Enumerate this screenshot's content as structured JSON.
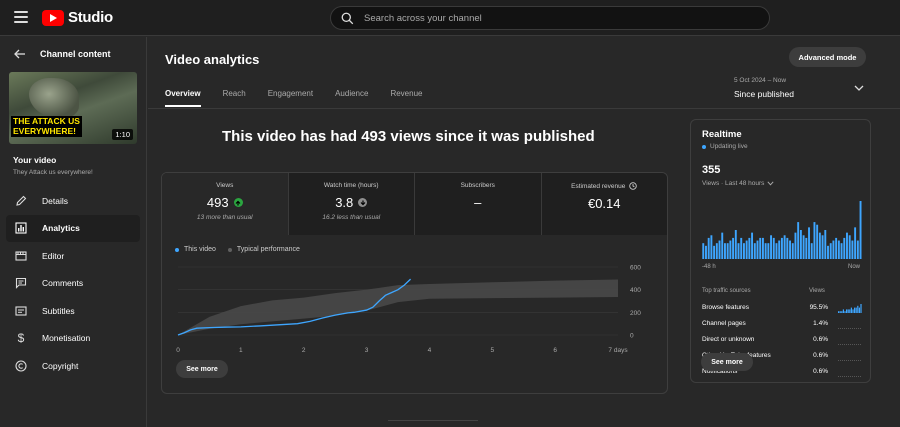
{
  "header": {
    "brand": "Studio",
    "search_placeholder": "Search across your channel"
  },
  "sidebar": {
    "back_label": "Channel content",
    "thumbnail": {
      "caption_line1": "THE ATTACK US",
      "caption_line2": "EVERYWHERE!",
      "duration": "1:10"
    },
    "video_title": "Your video",
    "video_subtitle": "They Attack us everywhere!",
    "items": [
      {
        "label": "Details",
        "icon": "pencil-icon"
      },
      {
        "label": "Analytics",
        "icon": "analytics-icon",
        "active": true
      },
      {
        "label": "Editor",
        "icon": "editor-icon"
      },
      {
        "label": "Comments",
        "icon": "comments-icon"
      },
      {
        "label": "Subtitles",
        "icon": "subtitles-icon"
      },
      {
        "label": "Monetisation",
        "icon": "dollar-icon"
      },
      {
        "label": "Copyright",
        "icon": "copyright-icon"
      }
    ]
  },
  "main": {
    "title": "Video analytics",
    "advanced_mode": "Advanced mode",
    "tabs": [
      {
        "label": "Overview",
        "active": true
      },
      {
        "label": "Reach"
      },
      {
        "label": "Engagement"
      },
      {
        "label": "Audience"
      },
      {
        "label": "Revenue"
      }
    ],
    "date_range": {
      "line1": "5 Oct 2024 – Now",
      "line2": "Since published"
    },
    "headline": "This video has had 493 views since it was published",
    "metrics": [
      {
        "label": "Views",
        "value": "493",
        "sub": "13 more than usual",
        "badge": "up",
        "active": true
      },
      {
        "label": "Watch time (hours)",
        "value": "3.8",
        "sub": "16.2 less than usual",
        "badge": "down"
      },
      {
        "label": "Subscribers",
        "value": "–",
        "sub": ""
      },
      {
        "label": "Estimated revenue",
        "value": "€0.14",
        "sub": "",
        "info": true
      }
    ],
    "legend": {
      "this_video": "This video",
      "typical": "Typical performance"
    },
    "see_more": "See more"
  },
  "chart_data": {
    "type": "line",
    "x_ticks": [
      "0",
      "1",
      "2",
      "3",
      "4",
      "5",
      "6",
      "7 days"
    ],
    "y_ticks": [
      "0",
      "200",
      "400",
      "600"
    ],
    "ylim": [
      0,
      600
    ],
    "xlim": [
      0,
      7
    ],
    "series": [
      {
        "name": "This video",
        "x": [
          0,
          0.1,
          0.2,
          0.3,
          0.5,
          0.8,
          1.0,
          1.3,
          1.6,
          1.9,
          2.1,
          2.3,
          2.5,
          2.7,
          2.8,
          3.0,
          3.1,
          3.2,
          3.3,
          3.4,
          3.5,
          3.6,
          3.7
        ],
        "values": [
          0,
          20,
          45,
          60,
          65,
          70,
          72,
          80,
          90,
          100,
          120,
          150,
          175,
          195,
          200,
          220,
          245,
          300,
          350,
          375,
          400,
          440,
          493
        ]
      },
      {
        "name": "Typical performance",
        "band_x": [
          0,
          0.5,
          1,
          1.5,
          2,
          2.5,
          3,
          3.5,
          4,
          5,
          6,
          7
        ],
        "band_low": [
          0,
          55,
          95,
          120,
          145,
          170,
          215,
          290,
          320,
          325,
          330,
          335
        ],
        "band_high": [
          0,
          160,
          255,
          305,
          330,
          370,
          400,
          440,
          450,
          465,
          480,
          490
        ]
      }
    ]
  },
  "realtime": {
    "title": "Realtime",
    "status": "Updating live",
    "number": "355",
    "subtitle": "Views · Last 48 hours",
    "bars": [
      6,
      5,
      8,
      9,
      5,
      6,
      7,
      10,
      6,
      6,
      7,
      8,
      11,
      6,
      8,
      6,
      7,
      8,
      10,
      6,
      7,
      8,
      8,
      6,
      6,
      9,
      8,
      6,
      7,
      8,
      9,
      8,
      7,
      6,
      10,
      14,
      11,
      9,
      8,
      12,
      6,
      14,
      13,
      10,
      9,
      11,
      5,
      6,
      7,
      8,
      7,
      6,
      8,
      10,
      9,
      7,
      12,
      7,
      22
    ],
    "axis_left": "-48 h",
    "axis_right": "Now",
    "sources_header": {
      "left": "Top traffic sources",
      "right": "Views"
    },
    "sources": [
      {
        "name": "Browse features",
        "pct": "95.5%",
        "trend": [
          1,
          1,
          1,
          2,
          1,
          2,
          2,
          2,
          3,
          2,
          3,
          3,
          4,
          3,
          5
        ]
      },
      {
        "name": "Channel pages",
        "pct": "1.4%"
      },
      {
        "name": "Direct or unknown",
        "pct": "0.6%"
      },
      {
        "name": "Other YouTube features",
        "pct": "0.6%"
      },
      {
        "name": "Notifications",
        "pct": "0.6%"
      }
    ],
    "see_more": "See more"
  },
  "colors": {
    "accent": "#3ea6ff",
    "green": "#2ba640",
    "bg": "#282828",
    "topbar": "#1f1f1f"
  }
}
